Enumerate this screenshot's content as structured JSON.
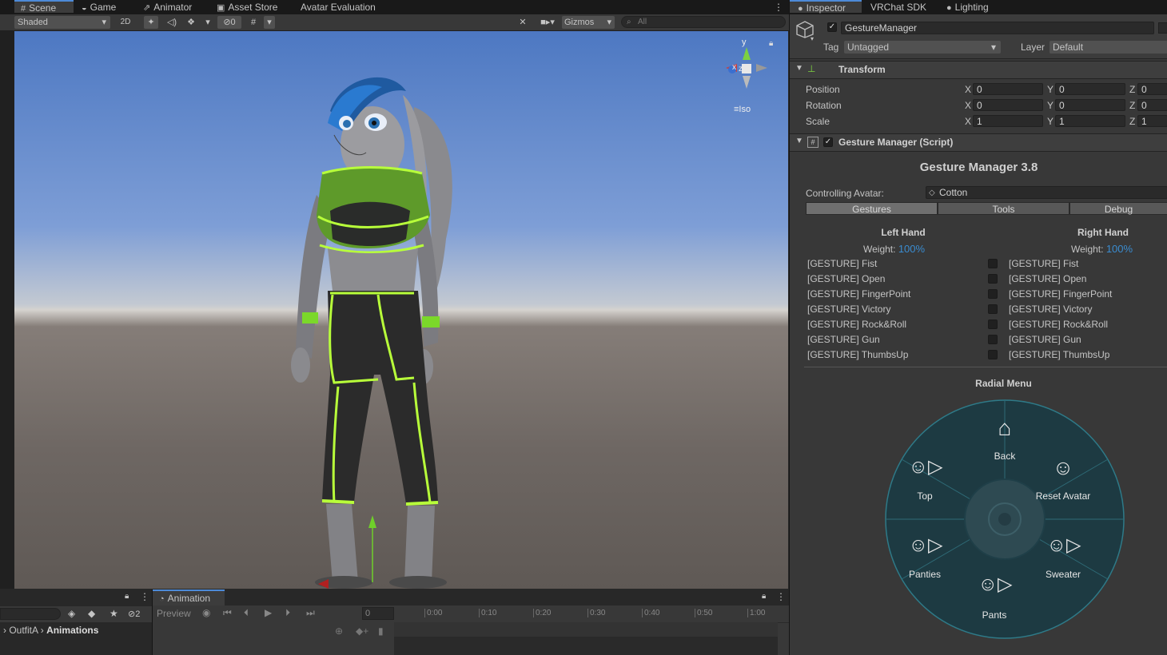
{
  "scene_tabs": [
    {
      "label": "Scene",
      "icon": "grid-icon",
      "active": true
    },
    {
      "label": "Game",
      "icon": "gamepad-icon",
      "active": false
    },
    {
      "label": "Animator",
      "icon": "animator-icon",
      "active": false
    },
    {
      "label": "Asset Store",
      "icon": "store-bag-icon",
      "active": false
    },
    {
      "label": "Avatar Evaluation",
      "icon": "",
      "active": false
    }
  ],
  "scene_toolbar": {
    "shading": "Shaded",
    "mode_2d": "2D",
    "hidden_count": "0",
    "gizmos": "Gizmos",
    "search_placeholder": "All"
  },
  "gizmo": {
    "y": "y",
    "x": "x",
    "z": "z",
    "projection": "Iso"
  },
  "inspector_tabs": [
    {
      "label": "Inspector",
      "icon": "info-icon",
      "active": true
    },
    {
      "label": "VRChat SDK",
      "icon": "",
      "active": false
    },
    {
      "label": "Lighting",
      "icon": "bulb-icon",
      "active": false
    }
  ],
  "object": {
    "name": "GestureManager",
    "tag_label": "Tag",
    "tag": "Untagged",
    "layer_label": "Layer",
    "layer": "Default"
  },
  "transform": {
    "title": "Transform",
    "rows": [
      {
        "label": "Position",
        "x": "0",
        "y": "0",
        "z": "0"
      },
      {
        "label": "Rotation",
        "x": "0",
        "y": "0",
        "z": "0"
      },
      {
        "label": "Scale",
        "x": "1",
        "y": "1",
        "z": "1"
      }
    ]
  },
  "script": {
    "title": "Gesture Manager (Script)",
    "heading": "Gesture Manager 3.8",
    "controlling_label": "Controlling Avatar:",
    "controlling_value": "Cotton",
    "tabs": [
      {
        "label": "Gestures",
        "active": true
      },
      {
        "label": "Tools",
        "active": false
      },
      {
        "label": "Debug",
        "active": false
      }
    ],
    "left_hand": {
      "title": "Left Hand",
      "weight_label": "Weight:",
      "weight_value": "100%"
    },
    "right_hand": {
      "title": "Right Hand",
      "weight_label": "Weight:",
      "weight_value": "100%"
    },
    "gestures": [
      "[GESTURE] Fist",
      "[GESTURE] Open",
      "[GESTURE] FingerPoint",
      "[GESTURE] Victory",
      "[GESTURE] Rock&Roll",
      "[GESTURE] Gun",
      "[GESTURE] ThumbsUp"
    ],
    "radial_title": "Radial Menu",
    "radial_items": [
      {
        "label": "Back",
        "icon": "back-icon"
      },
      {
        "label": "Reset Avatar",
        "icon": "reset-avatar-icon"
      },
      {
        "label": "Sweater",
        "icon": "toggle-sweater-icon"
      },
      {
        "label": "Pants",
        "icon": "toggle-pants-icon"
      },
      {
        "label": "Panties",
        "icon": "toggle-panties-icon"
      },
      {
        "label": "Top",
        "icon": "toggle-top-icon"
      }
    ]
  },
  "animation": {
    "title": "Animation",
    "preview": "Preview",
    "frame": "0",
    "ruler": [
      "0:00",
      "0:10",
      "0:20",
      "0:30",
      "0:40",
      "0:50",
      "1:00"
    ]
  },
  "project": {
    "hidden_count": "2",
    "breadcrumb": [
      "OutfitA",
      "Animations"
    ]
  },
  "colors": {
    "accent": "#4d8ad8",
    "percent": "#3a8cd0",
    "radial_ring": "#1f3f48",
    "radial_border": "#2e7a88"
  }
}
